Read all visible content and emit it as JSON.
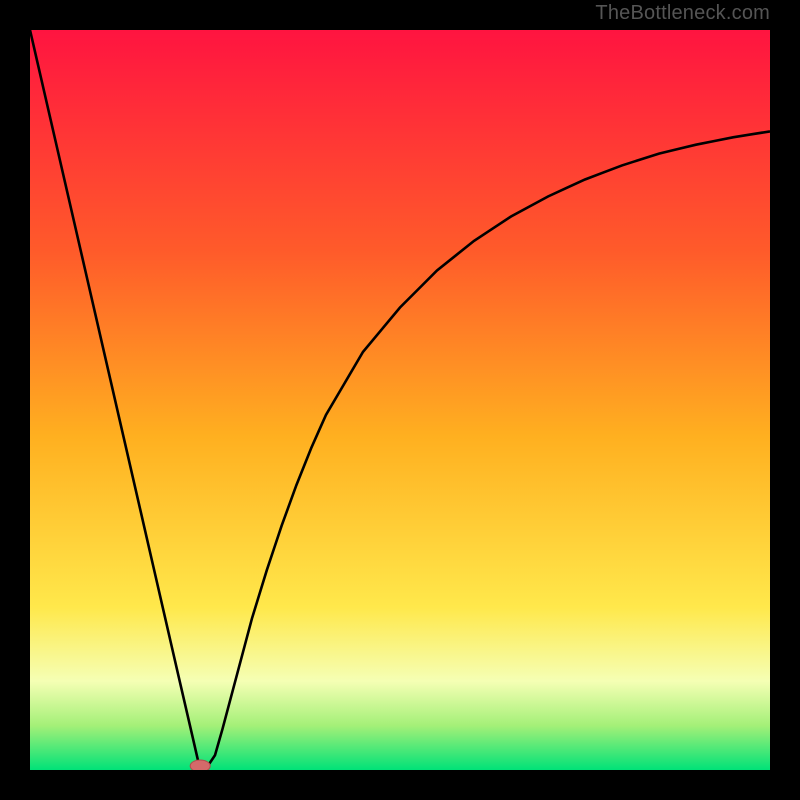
{
  "attribution": "TheBottleneck.com",
  "colors": {
    "frame": "#000000",
    "grad_top": "#ff1440",
    "grad_upper": "#ff5030",
    "grad_mid": "#ffb020",
    "grad_lower": "#ffe84b",
    "grad_green1": "#f0ffb0",
    "grad_green2": "#a0f070",
    "grad_green3": "#00e278",
    "curve": "#000000",
    "marker_fill": "#d46a6a",
    "marker_stroke": "#b24c4c"
  },
  "chart_data": {
    "type": "line",
    "title": "",
    "xlabel": "",
    "ylabel": "",
    "xlim": [
      0,
      100
    ],
    "ylim": [
      0,
      100
    ],
    "x": [
      0,
      2,
      4,
      6,
      8,
      10,
      12,
      14,
      16,
      18,
      20,
      22,
      23,
      24,
      25,
      26,
      28,
      30,
      32,
      34,
      36,
      38,
      40,
      45,
      50,
      55,
      60,
      65,
      70,
      75,
      80,
      85,
      90,
      95,
      100
    ],
    "values": [
      100,
      91.3,
      82.6,
      73.9,
      65.2,
      56.5,
      47.8,
      39.1,
      30.4,
      21.7,
      13.0,
      4.35,
      0,
      0.5,
      2.0,
      5.5,
      13.0,
      20.5,
      27.0,
      33.0,
      38.5,
      43.5,
      48.0,
      56.5,
      62.5,
      67.5,
      71.5,
      74.8,
      77.5,
      79.8,
      81.7,
      83.3,
      84.5,
      85.5,
      86.3
    ],
    "marker": {
      "x": 23,
      "y": 0
    },
    "gradient_bands": [
      {
        "stop": 0.0,
        "color": "#ff1440"
      },
      {
        "stop": 0.3,
        "color": "#ff5b2a"
      },
      {
        "stop": 0.55,
        "color": "#ffb020"
      },
      {
        "stop": 0.78,
        "color": "#ffe84b"
      },
      {
        "stop": 0.88,
        "color": "#f5ffb4"
      },
      {
        "stop": 0.94,
        "color": "#a4f078"
      },
      {
        "stop": 1.0,
        "color": "#00e278"
      }
    ]
  }
}
